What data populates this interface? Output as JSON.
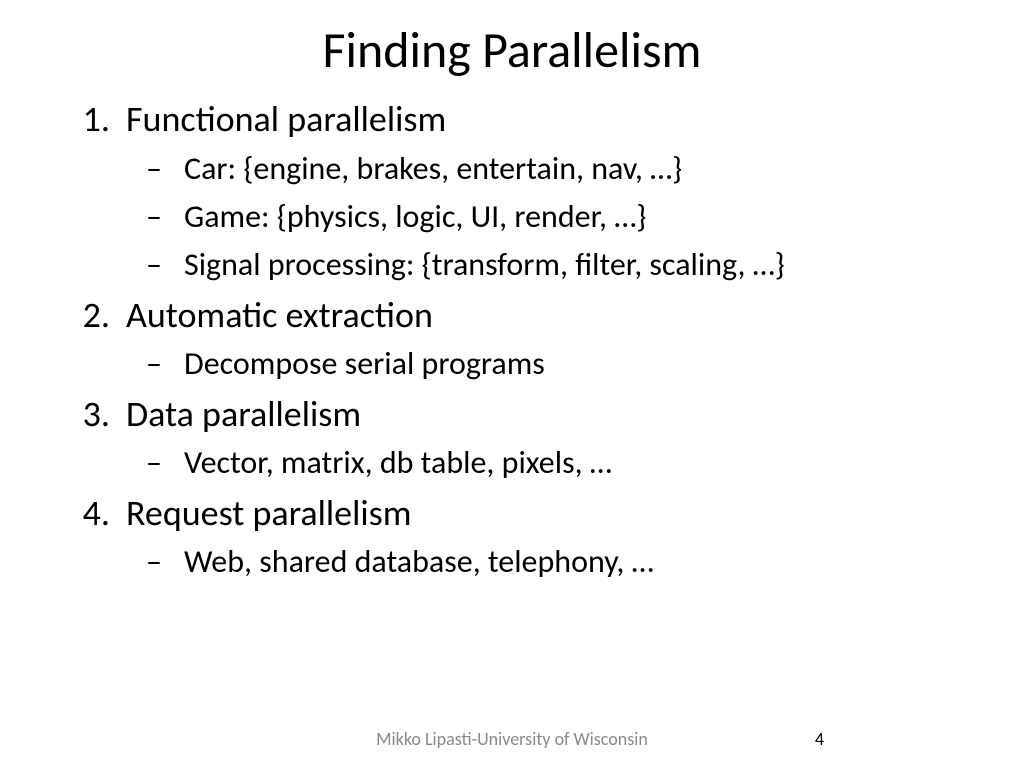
{
  "title": "Finding Parallelism",
  "items": [
    {
      "num": "1.",
      "text": "Functional parallelism",
      "sub": [
        "Car: {engine, brakes, entertain, nav, …}",
        "Game: {physics, logic, UI, render, …}",
        "Signal processing: {transform, filter, scaling, …}"
      ]
    },
    {
      "num": "2.",
      "text": "Automatic extraction",
      "sub": [
        "Decompose serial programs"
      ]
    },
    {
      "num": "3.",
      "text": "Data parallelism",
      "sub": [
        "Vector, matrix, db table, pixels, …"
      ]
    },
    {
      "num": "4.",
      "text": "Request parallelism",
      "sub": [
        "Web, shared database, telephony, …"
      ]
    }
  ],
  "footer": "Mikko Lipasti-University of Wisconsin",
  "page": "4"
}
